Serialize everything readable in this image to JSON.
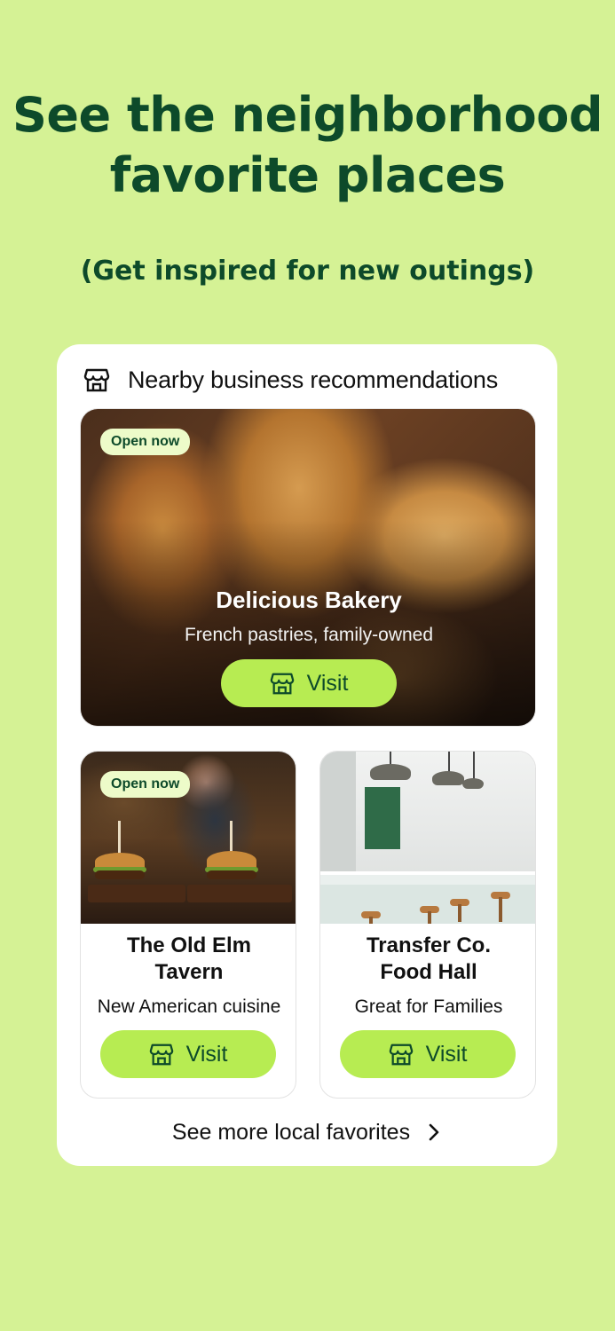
{
  "headline": {
    "line1": "See the neighborhood",
    "line2": "favorite places"
  },
  "subheadline": "(Get inspired for new outings)",
  "panel": {
    "title": "Nearby business recommendations",
    "icon": "storefront-icon"
  },
  "featured": {
    "badge": "Open now",
    "name": "Delicious Bakery",
    "description": "French pastries, family-owned",
    "button_label": "Visit",
    "image": "croissants-and-pastries-photo"
  },
  "cards": [
    {
      "badge": "Open now",
      "name_line1": "The Old Elm",
      "name_line2": "Tavern",
      "description": "New American cuisine",
      "button_label": "Visit",
      "image": "burgers-on-boards-photo"
    },
    {
      "name_line1": "Transfer Co.",
      "name_line2": "Food Hall",
      "description": "Great for Families",
      "button_label": "Visit",
      "image": "food-hall-counter-photo"
    }
  ],
  "more_link": "See more local favorites",
  "colors": {
    "background": "#d5f295",
    "heading": "#0d4a2a",
    "button": "#b7ec52",
    "badge": "#edfbc9"
  }
}
